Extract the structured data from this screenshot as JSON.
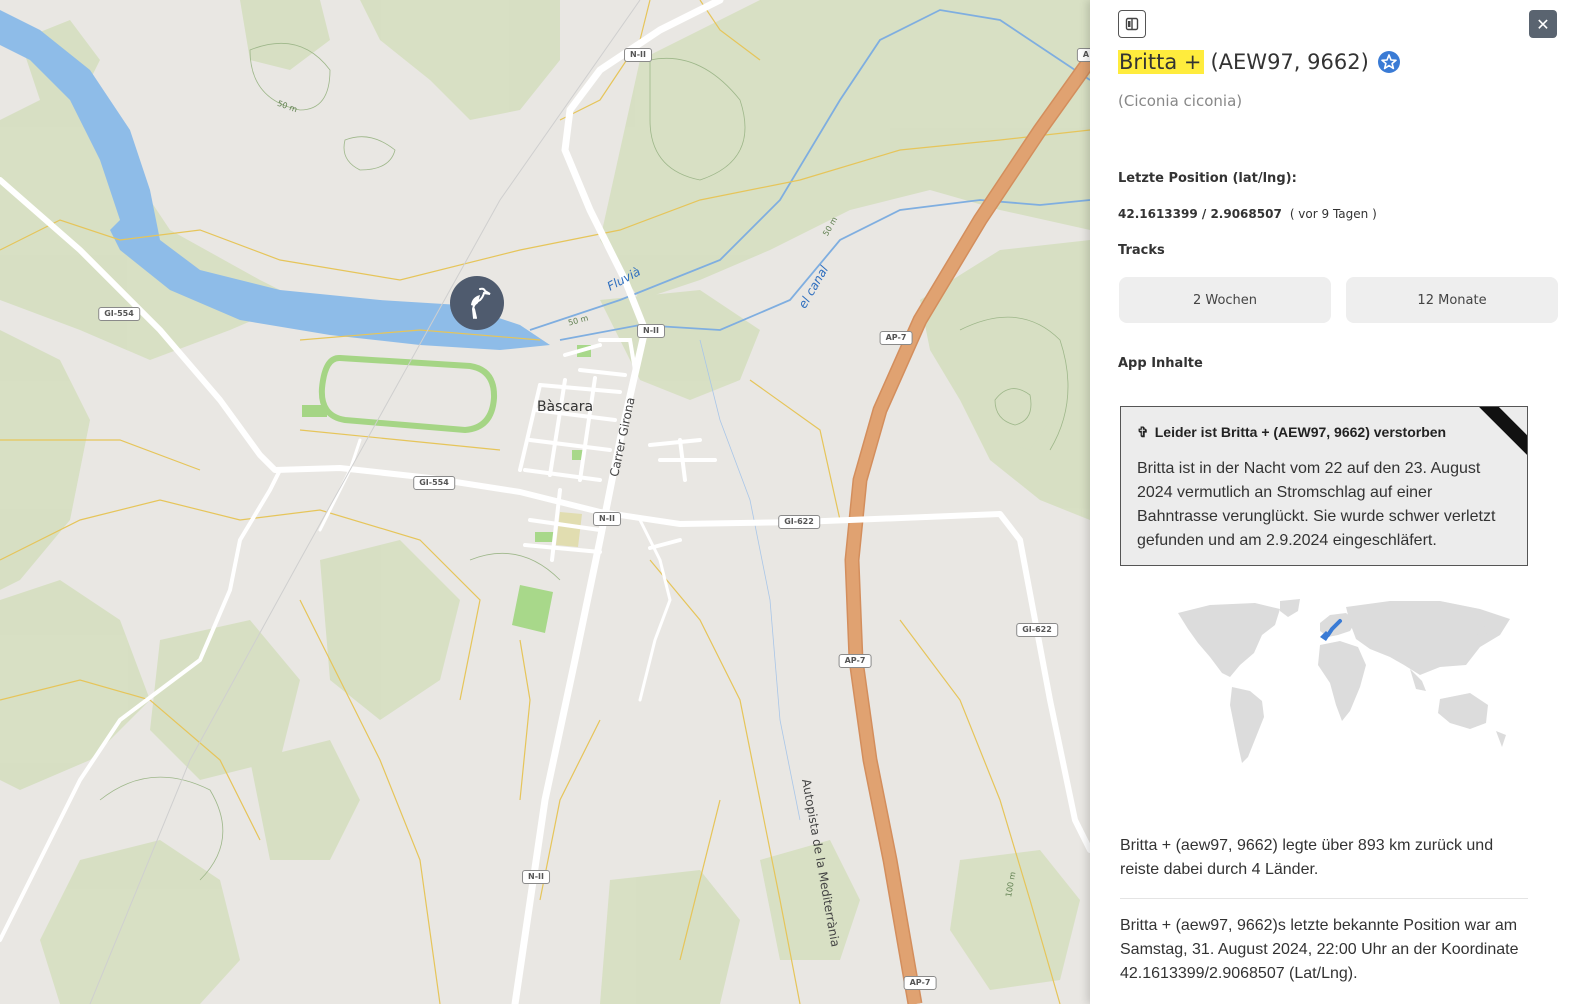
{
  "map": {
    "place_label": "Bàscara",
    "street_label": "Carrer Girona",
    "motorway_name": "Autopista de la Mediterrània",
    "river_labels": [
      "Fluvià",
      "el canal"
    ],
    "elevation_labels": [
      "50 m",
      "50 m",
      "50 m",
      "100 m"
    ],
    "road_shields": [
      "N-II",
      "N-II",
      "N-II",
      "N-II",
      "GI-554",
      "GI-554",
      "GI-622",
      "GI-622",
      "AP-7",
      "AP-7",
      "AP-7",
      "A"
    ],
    "marker_icon": "stork-icon",
    "colors": {
      "water": "#8ebce8",
      "forest": "#d6dfc0",
      "motorway": "#e0a271",
      "road": "#ffffff",
      "minor_road": "#e6c55a",
      "marker": "#4f5b6e"
    }
  },
  "panel": {
    "collapse_icon": "panel-collapse-icon",
    "close_label": "✕",
    "name": "Britta +",
    "id": "(AEW97, 9662)",
    "badge_icon": "star-badge-icon",
    "species": "(Ciconia ciconia)",
    "last_position_label": "Letzte Position (lat/lng):",
    "last_position_value": "42.1613399 / 2.9068507",
    "last_position_ago": "( vor 9 Tagen )",
    "tracks_label": "Tracks",
    "tracks": [
      "2 Wochen",
      "12 Monate"
    ],
    "app_content_label": "App Inhalte",
    "deceased": {
      "icon": "cross-icon",
      "title": "Leider ist Britta + (AEW97, 9662) verstorben",
      "text": "Britta ist in der Nacht vom 22 auf den 23. August 2024 vermutlich an Stromschlag auf einer Bahntrasse verunglückt. Sie wurde schwer verletzt gefunden und am 2.9.2024 eingeschläfert."
    },
    "distance_text": "Britta + (aew97, 9662) legte über 893 km zurück und reiste dabei durch 4 Länder.",
    "last_known_text": "Britta + (aew97, 9662)s letzte bekannte Position war am Samstag, 31. August 2024, 22:00 Uhr an der Koordinate 42.1613399/2.9068507 (Lat/Lng).",
    "highlight_color": "#ffec3d",
    "route_color": "#3a7bd5"
  }
}
